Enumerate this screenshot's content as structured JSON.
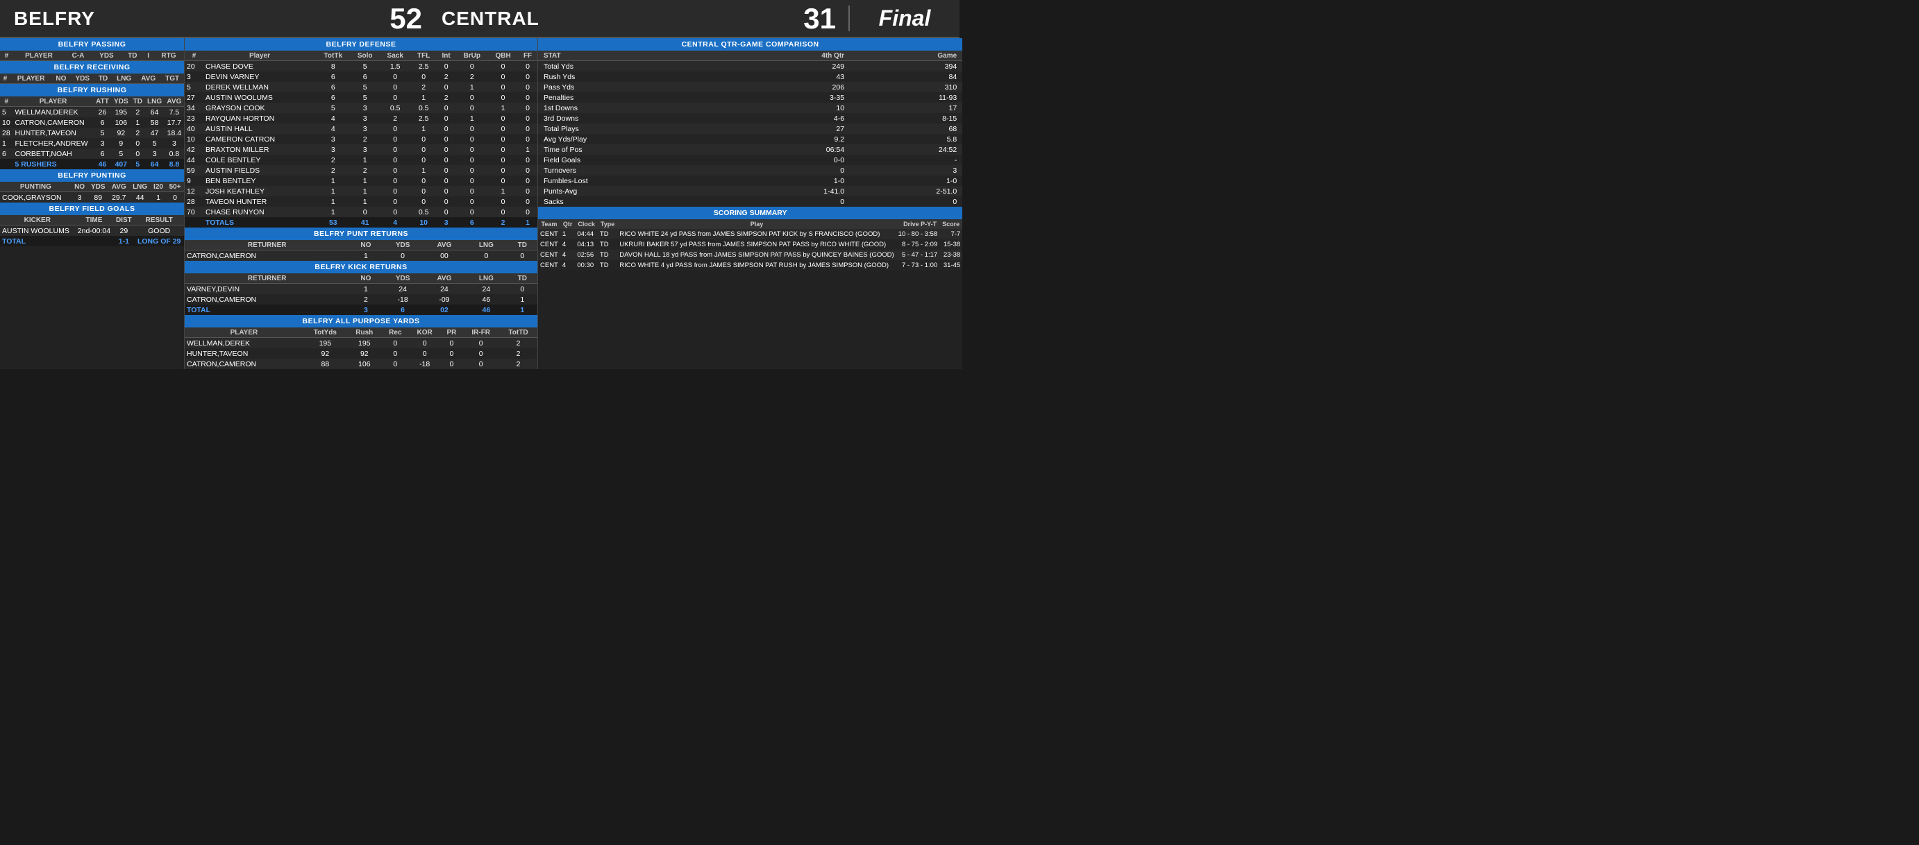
{
  "header": {
    "team_left": "BELFRY",
    "score_left": "52",
    "team_right": "CENTRAL",
    "score_right": "31",
    "status": "Final"
  },
  "belfry_passing": {
    "title": "BELFRY PASSING",
    "columns": [
      "#",
      "PLAYER",
      "C-A",
      "YDS",
      "TD",
      "I",
      "RTG"
    ],
    "rows": []
  },
  "belfry_receiving": {
    "title": "BELFRY RECEIVING",
    "columns": [
      "#",
      "PLAYER",
      "NO",
      "YDS",
      "TD",
      "LNG",
      "AVG",
      "TGT"
    ],
    "rows": []
  },
  "belfry_rushing": {
    "title": "BELFRY RUSHING",
    "columns": [
      "#",
      "PLAYER",
      "ATT",
      "YDS",
      "TD",
      "LNG",
      "AVG"
    ],
    "rows": [
      [
        "5",
        "WELLMAN,DEREK",
        "26",
        "195",
        "2",
        "64",
        "7.5"
      ],
      [
        "10",
        "CATRON,CAMERON",
        "6",
        "106",
        "1",
        "58",
        "17.7"
      ],
      [
        "28",
        "HUNTER,TAVEON",
        "5",
        "92",
        "2",
        "47",
        "18.4"
      ],
      [
        "1",
        "FLETCHER,ANDREW",
        "3",
        "9",
        "0",
        "5",
        "3"
      ],
      [
        "6",
        "CORBETT,NOAH",
        "6",
        "5",
        "0",
        "3",
        "0.8"
      ]
    ],
    "total_label": "5 RUSHERS",
    "total": [
      "46",
      "407",
      "5",
      "64",
      "8.8"
    ]
  },
  "belfry_punting": {
    "title": "BELFRY PUNTING",
    "columns": [
      "PUNTING",
      "NO",
      "YDS",
      "AVG",
      "LNG",
      "I20",
      "50+"
    ],
    "rows": [
      [
        "COOK,GRAYSON",
        "3",
        "89",
        "29.7",
        "44",
        "1",
        "0"
      ]
    ]
  },
  "belfry_field_goals": {
    "title": "BELFRY FIELD GOALS",
    "columns": [
      "KICKER",
      "TIME",
      "DIST",
      "RESULT"
    ],
    "rows": [
      [
        "AUSTIN WOOLUMS",
        "2nd-00:04",
        "29",
        "GOOD"
      ]
    ],
    "total_label": "TOTAL",
    "total": [
      "1-1",
      "LONG OF 29"
    ]
  },
  "belfry_defense": {
    "title": "BELFRY DEFENSE",
    "columns": [
      "#",
      "Player",
      "TotTk",
      "Solo",
      "Sack",
      "TFL",
      "Int",
      "BrUp",
      "QBH",
      "FF"
    ],
    "rows": [
      [
        "20",
        "CHASE DOVE",
        "8",
        "5",
        "1.5",
        "2.5",
        "0",
        "0",
        "0",
        "0"
      ],
      [
        "3",
        "DEVIN VARNEY",
        "6",
        "6",
        "0",
        "0",
        "2",
        "2",
        "0",
        "0"
      ],
      [
        "5",
        "DEREK WELLMAN",
        "6",
        "5",
        "0",
        "2",
        "0",
        "1",
        "0",
        "0"
      ],
      [
        "27",
        "AUSTIN WOOLUMS",
        "6",
        "5",
        "0",
        "1",
        "2",
        "0",
        "0",
        "0"
      ],
      [
        "34",
        "GRAYSON COOK",
        "5",
        "3",
        "0.5",
        "0.5",
        "0",
        "0",
        "1",
        "0"
      ],
      [
        "23",
        "RAYQUAN HORTON",
        "4",
        "3",
        "2",
        "2.5",
        "0",
        "1",
        "0",
        "0"
      ],
      [
        "40",
        "AUSTIN HALL",
        "4",
        "3",
        "0",
        "1",
        "0",
        "0",
        "0",
        "0"
      ],
      [
        "10",
        "CAMERON CATRON",
        "3",
        "2",
        "0",
        "0",
        "0",
        "0",
        "0",
        "0"
      ],
      [
        "42",
        "BRAXTON MILLER",
        "3",
        "3",
        "0",
        "0",
        "0",
        "0",
        "0",
        "1"
      ],
      [
        "44",
        "COLE BENTLEY",
        "2",
        "1",
        "0",
        "0",
        "0",
        "0",
        "0",
        "0"
      ],
      [
        "59",
        "AUSTIN FIELDS",
        "2",
        "2",
        "0",
        "1",
        "0",
        "0",
        "0",
        "0"
      ],
      [
        "9",
        "BEN BENTLEY",
        "1",
        "1",
        "0",
        "0",
        "0",
        "0",
        "0",
        "0"
      ],
      [
        "12",
        "JOSH KEATHLEY",
        "1",
        "1",
        "0",
        "0",
        "0",
        "0",
        "1",
        "0"
      ],
      [
        "28",
        "TAVEON HUNTER",
        "1",
        "1",
        "0",
        "0",
        "0",
        "0",
        "0",
        "0"
      ],
      [
        "70",
        "CHASE RUNYON",
        "1",
        "0",
        "0",
        "0.5",
        "0",
        "0",
        "0",
        "0"
      ]
    ],
    "total_label": "TOTALS",
    "total": [
      "53",
      "41",
      "4",
      "10",
      "3",
      "6",
      "2",
      "1"
    ]
  },
  "belfry_punt_returns": {
    "title": "BELFRY PUNT RETURNS",
    "columns": [
      "RETURNER",
      "NO",
      "YDS",
      "AVG",
      "LNG",
      "TD"
    ],
    "rows": [
      [
        "CATRON,CAMERON",
        "1",
        "0",
        "00",
        "0",
        "0"
      ]
    ]
  },
  "belfry_kick_returns": {
    "title": "BELFRY KICK RETURNS",
    "columns": [
      "RETURNER",
      "NO",
      "YDS",
      "AVG",
      "LNG",
      "TD"
    ],
    "rows": [
      [
        "VARNEY,DEVIN",
        "1",
        "24",
        "24",
        "24",
        "0"
      ],
      [
        "CATRON,CAMERON",
        "2",
        "-18",
        "-09",
        "46",
        "1"
      ]
    ],
    "total_label": "TOTAL",
    "total": [
      "3",
      "6",
      "02",
      "46",
      "1"
    ]
  },
  "belfry_all_purpose": {
    "title": "BELFRY ALL PURPOSE YARDS",
    "columns": [
      "PLAYER",
      "TotYds",
      "Rush",
      "Rec",
      "KOR",
      "PR",
      "IR-FR",
      "TotTD"
    ],
    "rows": [
      [
        "WELLMAN,DEREK",
        "195",
        "195",
        "0",
        "0",
        "0",
        "0",
        "2"
      ],
      [
        "HUNTER,TAVEON",
        "92",
        "92",
        "0",
        "0",
        "0",
        "0",
        "2"
      ],
      [
        "CATRON,CAMERON",
        "88",
        "106",
        "0",
        "-18",
        "0",
        "0",
        "2"
      ]
    ]
  },
  "central_qtr": {
    "title": "CENTRAL QTR-GAME COMPARISON",
    "col_stat": "STAT",
    "col_4th": "4th Qtr",
    "col_game": "Game",
    "rows": [
      [
        "Total Yds",
        "249",
        "394"
      ],
      [
        "Rush Yds",
        "43",
        "84"
      ],
      [
        "Pass Yds",
        "206",
        "310"
      ],
      [
        "Penalties",
        "3-35",
        "11-93"
      ],
      [
        "1st Downs",
        "10",
        "17"
      ],
      [
        "3rd Downs",
        "4-6",
        "8-15"
      ],
      [
        "Total Plays",
        "27",
        "68"
      ],
      [
        "Avg Yds/Play",
        "9.2",
        "5.8"
      ],
      [
        "Time of Pos",
        "06:54",
        "24:52"
      ],
      [
        "Field Goals",
        "0-0",
        "-"
      ],
      [
        "Turnovers",
        "0",
        "3"
      ],
      [
        "Fumbles-Lost",
        "1-0",
        "1-0"
      ],
      [
        "Punts-Avg",
        "1-41.0",
        "2-51.0"
      ],
      [
        "Sacks",
        "0",
        "0"
      ]
    ]
  },
  "scoring_summary": {
    "title": "SCORING SUMMARY",
    "columns": [
      "Team",
      "Qtr",
      "Clock",
      "Type",
      "Play",
      "Drive P-Y-T",
      "Score"
    ],
    "rows": [
      {
        "team": "CENT",
        "qtr": "1",
        "clock": "04:44",
        "type": "TD",
        "play": "RICO WHITE 24 yd PASS from JAMES SIMPSON PAT KICK by S FRANCISCO (GOOD)",
        "drive": "10 - 80 - 3:58",
        "score": "7-7"
      },
      {
        "team": "CENT",
        "qtr": "4",
        "clock": "04:13",
        "type": "TD",
        "play": "UKRURI BAKER 57 yd PASS from JAMES SIMPSON PAT PASS by RICO WHITE (GOOD)",
        "drive": "8 - 75 - 2:09",
        "score": "15-38"
      },
      {
        "team": "CENT",
        "qtr": "4",
        "clock": "02:56",
        "type": "TD",
        "play": "DAVON HALL 18 yd PASS from JAMES SIMPSON PAT PASS by QUINCEY BAINES (GOOD)",
        "drive": "5 - 47 - 1:17",
        "score": "23-38"
      },
      {
        "team": "CENT",
        "qtr": "4",
        "clock": "00:30",
        "type": "TD",
        "play": "RICO WHITE 4 yd PASS from JAMES SIMPSON PAT RUSH by JAMES SIMPSON (GOOD)",
        "drive": "7 - 73 - 1:00",
        "score": "31-45"
      }
    ]
  }
}
